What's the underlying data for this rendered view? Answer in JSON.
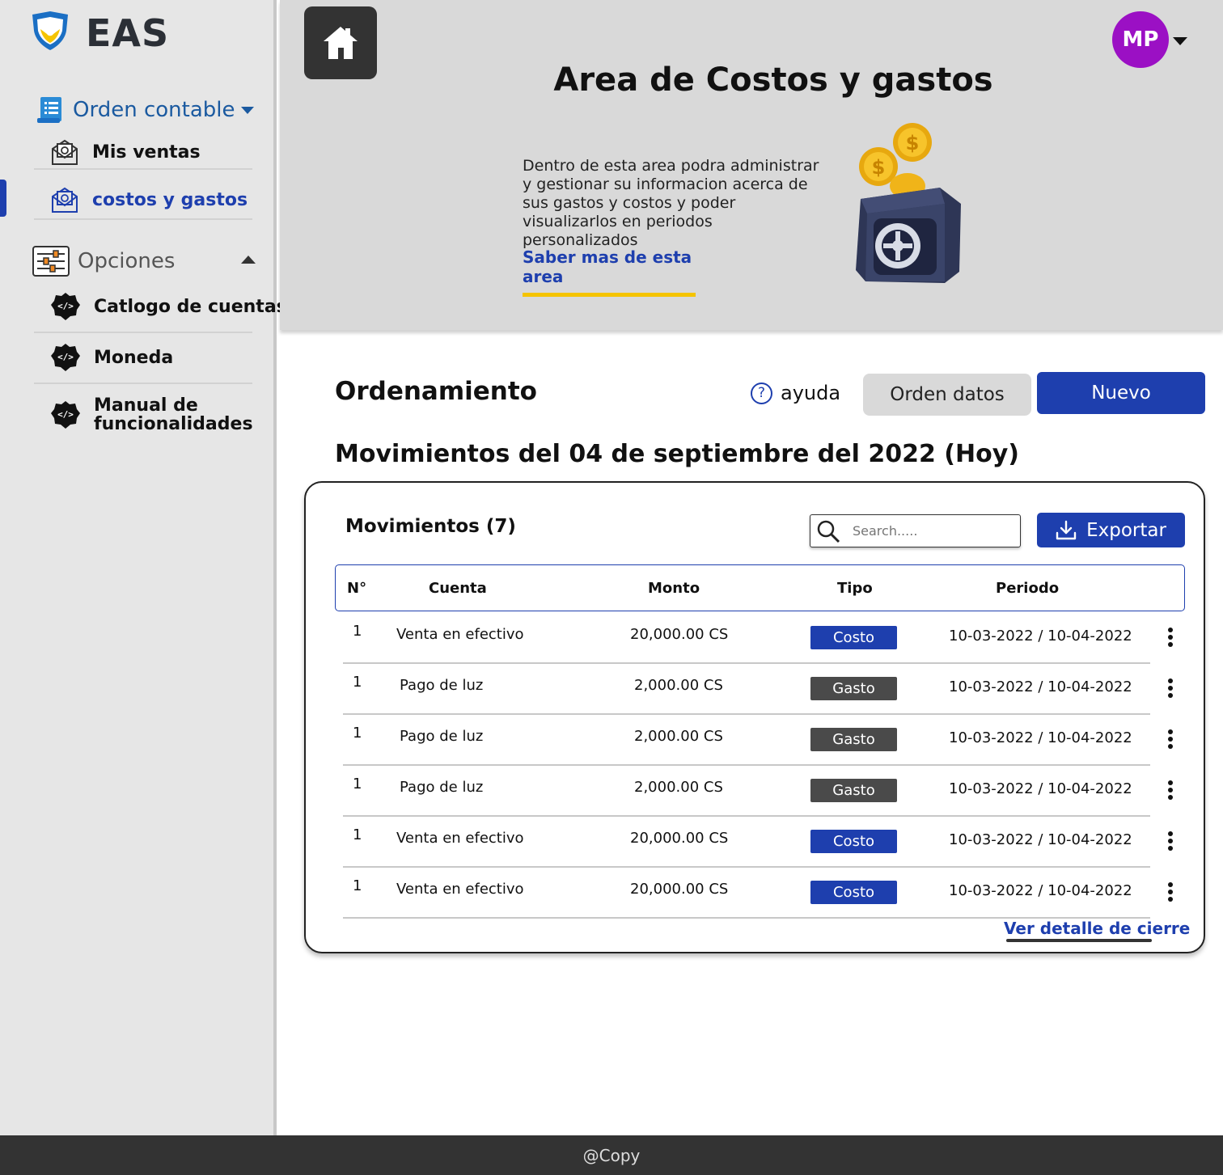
{
  "app": {
    "logo_text": "EAS"
  },
  "sidebar": {
    "orden_contable": "Orden contable",
    "items_orden": [
      {
        "label": "Mis ventas",
        "icon": "receipt-envelope-icon"
      },
      {
        "label": "costos y gastos",
        "icon": "receipt-envelope-icon"
      }
    ],
    "opciones": "Opciones",
    "items_opciones": [
      {
        "label": "Catlogo de cuentas",
        "icon": "code-gear-icon"
      },
      {
        "label": "Moneda",
        "icon": "code-gear-icon"
      },
      {
        "label_line1": "Manual de",
        "label_line2": "funcionalidades",
        "icon": "code-gear-icon"
      }
    ]
  },
  "header": {
    "avatar_initials": "MP",
    "title": "Area de Costos y gastos",
    "description": "Dentro de esta area podra administrar y gestionar su informacion acerca de sus gastos y costos y poder visualizarlos en periodos personalizados",
    "learn_more": "Saber mas de esta area"
  },
  "toolbar": {
    "section_title": "Ordenamiento",
    "help_label": "ayuda",
    "order_button": "Orden datos",
    "new_button": "Nuevo"
  },
  "movements": {
    "subtitle": "Movimientos del 04 de septiembre del 2022 (Hoy)",
    "card_title": "Movimientos (7)",
    "search_placeholder": "Search.....",
    "export_label": "Exportar",
    "columns": {
      "num": "N°",
      "cuenta": "Cuenta",
      "monto": "Monto",
      "tipo": "Tipo",
      "periodo": "Periodo"
    },
    "rows": [
      {
        "num": "1",
        "cuenta": "Venta en efectivo",
        "monto": "20,000.00 CS",
        "tipo": "Costo",
        "periodo": "10-03-2022 / 10-04-2022"
      },
      {
        "num": "1",
        "cuenta": "Pago de luz",
        "monto": "2,000.00 CS",
        "tipo": "Gasto",
        "periodo": "10-03-2022 / 10-04-2022"
      },
      {
        "num": "1",
        "cuenta": "Pago de luz",
        "monto": "2,000.00 CS",
        "tipo": "Gasto",
        "periodo": "10-03-2022 / 10-04-2022"
      },
      {
        "num": "1",
        "cuenta": "Pago de luz",
        "monto": "2,000.00 CS",
        "tipo": "Gasto",
        "periodo": "10-03-2022 / 10-04-2022"
      },
      {
        "num": "1",
        "cuenta": "Venta en efectivo",
        "monto": "20,000.00 CS",
        "tipo": "Costo",
        "periodo": "10-03-2022 / 10-04-2022"
      },
      {
        "num": "1",
        "cuenta": "Venta en efectivo",
        "monto": "20,000.00 CS",
        "tipo": "Costo",
        "periodo": "10-03-2022 / 10-04-2022"
      }
    ],
    "detail_link": "Ver detalle de cierre"
  },
  "footer": {
    "text": "@Copy"
  },
  "colors": {
    "primary": "#1e3fae",
    "accent": "#f5c400",
    "avatar": "#9b10c4",
    "gasto": "#4a4a4a"
  }
}
